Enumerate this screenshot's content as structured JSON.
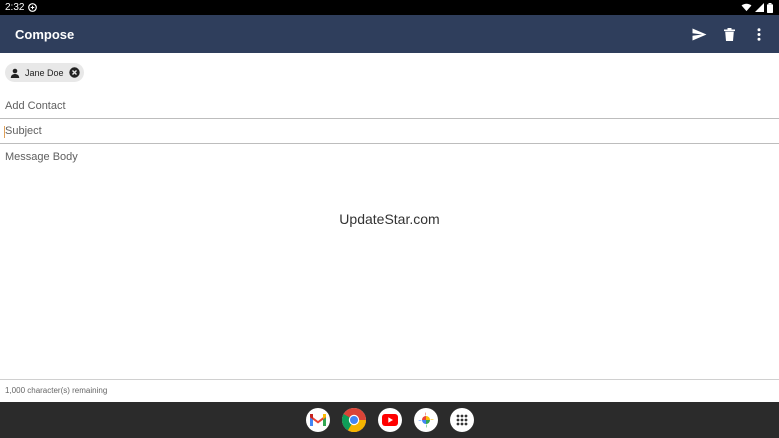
{
  "status_bar": {
    "time": "2:32"
  },
  "app_bar": {
    "title": "Compose",
    "actions": [
      {
        "icon": "send-icon"
      },
      {
        "icon": "trash-icon"
      },
      {
        "icon": "more-vert-icon"
      }
    ]
  },
  "recipients": [
    {
      "name": "Jane Doe"
    }
  ],
  "fields": {
    "add_contact_placeholder": "Add Contact",
    "subject_placeholder": "Subject",
    "body_placeholder": "Message Body"
  },
  "watermark": "UpdateStar.com",
  "footer": {
    "remaining": "1,000 character(s) remaining"
  },
  "dock": {
    "apps": [
      {
        "icon": "gmail-icon"
      },
      {
        "icon": "chrome-icon"
      },
      {
        "icon": "youtube-icon"
      },
      {
        "icon": "photos-icon"
      },
      {
        "icon": "app-drawer-icon"
      }
    ]
  },
  "colors": {
    "app_bar": "#2f3e5c",
    "status_bar": "#000000",
    "taskbar": "#2b2b2b"
  }
}
